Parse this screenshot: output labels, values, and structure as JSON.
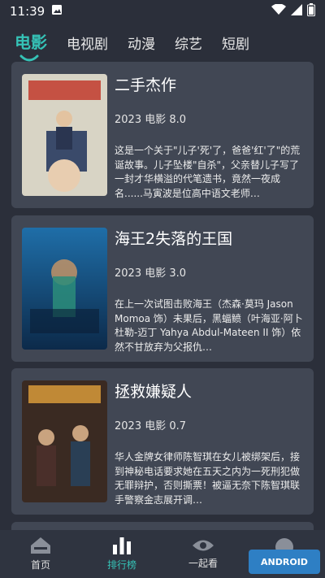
{
  "status_bar": {
    "time": "11:39"
  },
  "tabs": [
    {
      "label": "电影"
    },
    {
      "label": "电视剧"
    },
    {
      "label": "动漫"
    },
    {
      "label": "综艺"
    },
    {
      "label": "短剧"
    }
  ],
  "movies": [
    {
      "title": "二手杰作",
      "meta": "2023 电影 8.0",
      "desc": "这是一个关于\"儿子'死'了，爸爸'红'了\"的荒诞故事。儿子坠楼\"自杀\"，父亲替儿子写了一封才华横溢的代笔遗书，竟然一夜成名......马寅波是位高中语文老师…"
    },
    {
      "title": "海王2失落的王国",
      "meta": "2023 电影 3.0",
      "desc": "在上一次试图击败海王（杰森·莫玛 Jason Momoa 饰）未果后，黑蝠鲼（叶海亚·阿卜杜勒-迈丁 Yahya Abdul-Mateen II 饰）依然不甘放弃为父报仇…"
    },
    {
      "title": "拯救嫌疑人",
      "meta": "2023 电影 0.7",
      "desc": "华人金牌女律师陈智琪在女儿被绑架后，接到神秘电话要求她在五天之内为一死刑犯做无罪辩护，否则撕票！被逼无奈下陈智琪联手警察金志展开调…"
    }
  ],
  "bottom_nav": [
    {
      "label": "首页"
    },
    {
      "label": "排行榜"
    },
    {
      "label": "一起看"
    }
  ],
  "colors": {
    "accent": "#35c2b6",
    "card": "#414754",
    "background": "#2b2f3a"
  }
}
